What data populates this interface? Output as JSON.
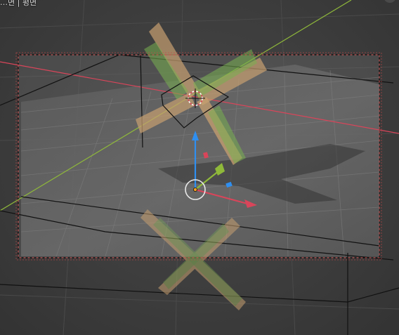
{
  "viewport": {
    "header": {
      "view_name": "…면 | 평면"
    },
    "icons": {
      "cursor": "3d-cursor-icon",
      "gizmo": "transform-gizmo-icon",
      "origin": "object-origin-icon"
    },
    "colors": {
      "background": "#3d3d3d",
      "x_axis": "#d9455a",
      "y_axis": "#8fb93a",
      "z_axis": "#2f8ff0",
      "camera_frame": "#c84848",
      "wood": "#c8a070",
      "green": "#78b050"
    }
  }
}
